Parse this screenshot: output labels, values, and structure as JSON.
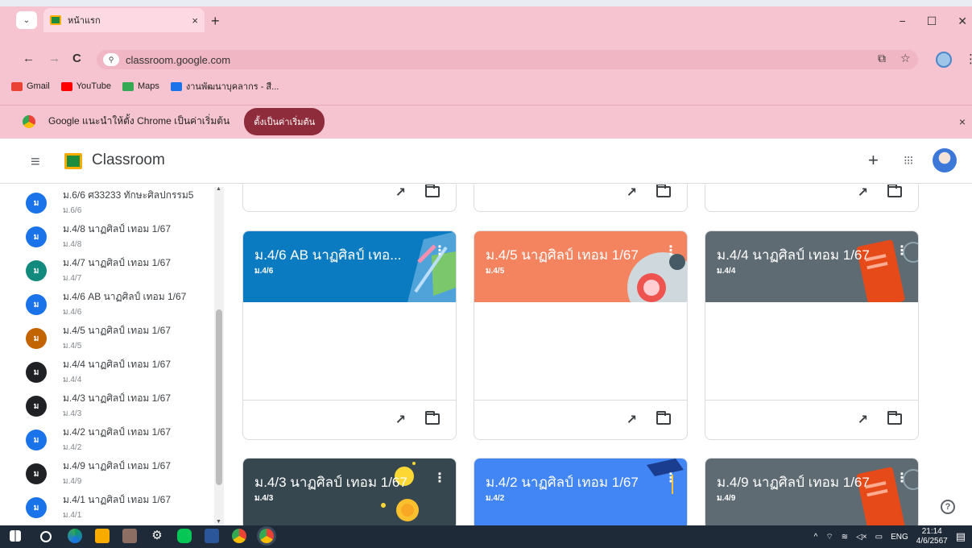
{
  "browser": {
    "tab_title": "หน้าแรก",
    "tab_close": "×",
    "new_tab": "+",
    "tab_list": "⌄",
    "window": {
      "minimize": "−",
      "maximize": "☐",
      "close": "✕"
    },
    "nav": {
      "back": "←",
      "forward": "→",
      "reload": "C"
    },
    "site_info": "⚲",
    "url": "classroom.google.com",
    "bookmarks": [
      {
        "label": "Gmail",
        "color": "#ea4335"
      },
      {
        "label": "YouTube",
        "color": "#ff0000"
      },
      {
        "label": "Maps",
        "color": "#34a853"
      },
      {
        "label": "งานพัฒนาบุคลากร - สี...",
        "color": "#1a73e8"
      }
    ],
    "infobar": {
      "message": "Google แนะนำให้ตั้ง Chrome เป็นค่าเริ่มต้น",
      "button": "ตั้งเป็นค่าเริ่มต้น",
      "close": "×"
    }
  },
  "app": {
    "menu_icon": "≡",
    "title": "Classroom",
    "add": "+",
    "apps": "⁝⁝⁝"
  },
  "sidebar": {
    "items": [
      {
        "avatar": "ม",
        "name": "ม.6/6 ศ33233 ทักษะศิลปกรรม5",
        "sub": "ม.6/6",
        "color": "#1a73e8"
      },
      {
        "avatar": "ม",
        "name": "ม.4/8 นาฏศิลป์ เทอม 1/67",
        "sub": "ม.4/8",
        "color": "#1a73e8"
      },
      {
        "avatar": "ม",
        "name": "ม.4/7 นาฏศิลป์ เทอม 1/67",
        "sub": "ม.4/7",
        "color": "#128a7e"
      },
      {
        "avatar": "ม",
        "name": "ม.4/6 AB นาฏศิลป์ เทอม 1/67",
        "sub": "ม.4/6",
        "color": "#1a73e8"
      },
      {
        "avatar": "ม",
        "name": "ม.4/5 นาฏศิลป์ เทอม 1/67",
        "sub": "ม.4/5",
        "color": "#c26401"
      },
      {
        "avatar": "ม",
        "name": "ม.4/4 นาฏศิลป์ เทอม 1/67",
        "sub": "ม.4/4",
        "color": "#202124"
      },
      {
        "avatar": "ม",
        "name": "ม.4/3 นาฏศิลป์ เทอม 1/67",
        "sub": "ม.4/3",
        "color": "#202124"
      },
      {
        "avatar": "ม",
        "name": "ม.4/2 นาฏศิลป์ เทอม 1/67",
        "sub": "ม.4/2",
        "color": "#1a73e8"
      },
      {
        "avatar": "ม",
        "name": "ม.4/9 นาฏศิลป์ เทอม 1/67",
        "sub": "ม.4/9",
        "color": "#202124"
      },
      {
        "avatar": "ม",
        "name": "ม.4/1 นาฏศิลป์ เทอม 1/67",
        "sub": "ม.4/1",
        "color": "#1a73e8"
      }
    ]
  },
  "cards": [
    {
      "title": "ม.4/6 AB นาฏศิลป์ เทอ...",
      "sub": "ม.4/6",
      "color": "#0b7bc1"
    },
    {
      "title": "ม.4/5 นาฏศิลป์ เทอม 1/67",
      "sub": "ม.4/5",
      "color": "#f4845f"
    },
    {
      "title": "ม.4/4 นาฏศิลป์ เทอม 1/67",
      "sub": "ม.4/4",
      "color": "#5f6b73"
    },
    {
      "title": "ม.4/3 นาฏศิลป์ เทอม 1/67",
      "sub": "ม.4/3",
      "color": "#37474f"
    },
    {
      "title": "ม.4/2 นาฏศิลป์ เทอม 1/67",
      "sub": "ม.4/2",
      "color": "#4285f4"
    },
    {
      "title": "ม.4/9 นาฏศิลป์ เทอม 1/67",
      "sub": "ม.4/9",
      "color": "#5f6b73"
    }
  ],
  "card_icons": {
    "trend": "↗",
    "kebab": "⋮"
  },
  "help": "?",
  "taskbar": {
    "lang": "ENG",
    "time": "21:14",
    "date": "4/6/2567"
  }
}
